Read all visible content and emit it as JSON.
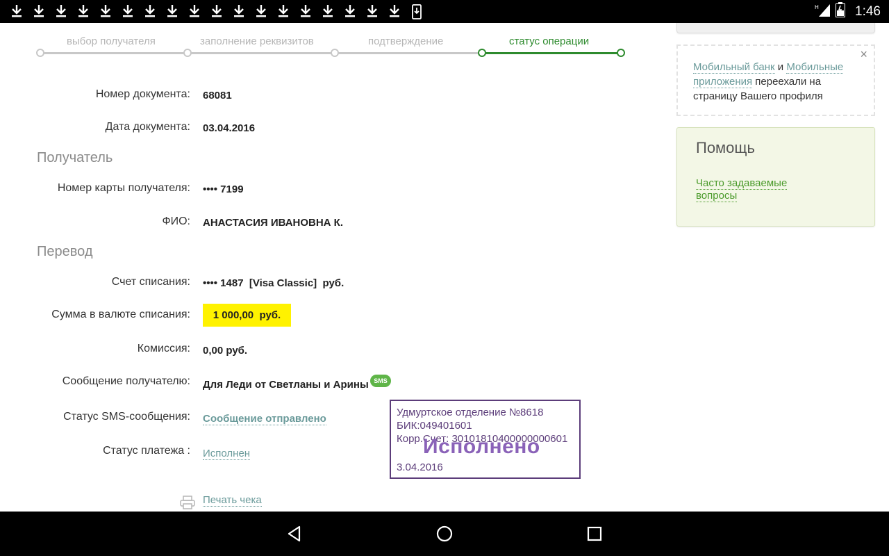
{
  "statusbar": {
    "download_icons": [
      "download-icon",
      "download-icon",
      "download-icon",
      "download-icon",
      "download-icon",
      "download-icon",
      "download-icon",
      "download-icon",
      "download-icon",
      "download-icon",
      "download-icon",
      "download-icon",
      "download-icon",
      "download-icon",
      "download-icon",
      "download-icon",
      "download-icon",
      "download-icon",
      "download-icon"
    ],
    "network": "H",
    "time": "1:46"
  },
  "steps": {
    "items": [
      "выбор получателя",
      "заполнение реквизитов",
      "подтверждение",
      "статус операции"
    ],
    "active_index": 3,
    "active_color": "#2e8b2e",
    "inactive_color": "#c8c8c8"
  },
  "doc": {
    "number_label": "Номер документа:",
    "number_value": "68081",
    "date_label": "Дата документа:",
    "date_value": "03.04.2016"
  },
  "recipient": {
    "section_title": "Получатель",
    "card_label": "Номер карты получателя:",
    "card_value": "•••• 7199",
    "name_label": "ФИО:",
    "name_value": "АНАСТАСИЯ ИВАНОВНА К."
  },
  "transfer": {
    "section_title": "Перевод",
    "account_label": "Счет списания:",
    "account_value": "•••• 1487  [Visa Classic]  руб.",
    "amount_label": "Сумма в валюте списания:",
    "amount_value": "1 000,00  руб.",
    "commission_label": "Комиссия:",
    "commission_value": "0,00 руб.",
    "message_label": "Сообщение получателю:",
    "message_value": "Для Леди от Светланы и Арины",
    "sms_badge": "SMS",
    "sms_status_label": "Статус SMS-сообщения:",
    "sms_status_value": "Сообщение отправлено",
    "payment_status_label": "Статус платежа :",
    "payment_status_value": "Исполнен"
  },
  "stamp": {
    "line1": "Удмуртское отделение №8618",
    "line2": "БИК:049401601",
    "line3": "Корр.Счет: 30101810400000000601",
    "status": "Исполнено",
    "date": "3.04.2016"
  },
  "print": {
    "label": "Печать чека"
  },
  "notice": {
    "link1": "Мобильный банк",
    "and": " и ",
    "link2": "Мобильные приложения",
    "rest": " переехали на страницу Вашего профиля",
    "close": "×"
  },
  "help": {
    "title": "Помощь",
    "faq_link": "Часто задаваемые вопросы"
  }
}
